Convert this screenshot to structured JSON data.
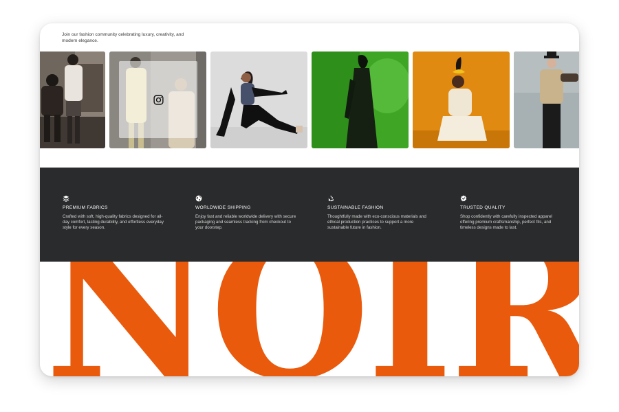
{
  "intro": {
    "text": "Join our fashion community celebrating luxury, creativity, and modern elegance."
  },
  "gallery": {
    "social_icon": "instagram-icon",
    "tiles": [
      {
        "subject": "two models seated in a clothing studio"
      },
      {
        "subject": "models in beige trench coats, highlighted with overlay"
      },
      {
        "subject": "model in black gloves and leggings on grey backdrop"
      },
      {
        "subject": "model in dark dress on green backdrop"
      },
      {
        "subject": "model in cream outfit with headpiece on orange backdrop"
      },
      {
        "subject": "model in hat and beige jacket on grey-blue backdrop"
      }
    ]
  },
  "features": [
    {
      "icon": "layers-icon",
      "title": "PREMIUM FABRICS",
      "text": "Crafted with soft, high-quality fabrics designed for all-day comfort, lasting durability, and effortless everyday style for every season."
    },
    {
      "icon": "globe-icon",
      "title": "WORLDWIDE SHIPPING",
      "text": "Enjoy fast and reliable worldwide delivery with secure packaging and seamless tracking from checkout to your doorstep."
    },
    {
      "icon": "recycle-icon",
      "title": "SUSTAINABLE FASHION",
      "text": "Thoughtfully made with eco-conscious materials and ethical production practices to support a more sustainable future in fashion."
    },
    {
      "icon": "verified-badge-icon",
      "title": "TRUSTED QUALITY",
      "text": "Shop confidently with carefully inspected apparel offering premium craftsmanship, perfect fits, and timeless designs made to last."
    }
  ],
  "brand": {
    "word": "NOIR",
    "color": "#ea5a0c"
  },
  "colors": {
    "dark_band": "#2a2b2c",
    "accent": "#ea5a0c"
  }
}
